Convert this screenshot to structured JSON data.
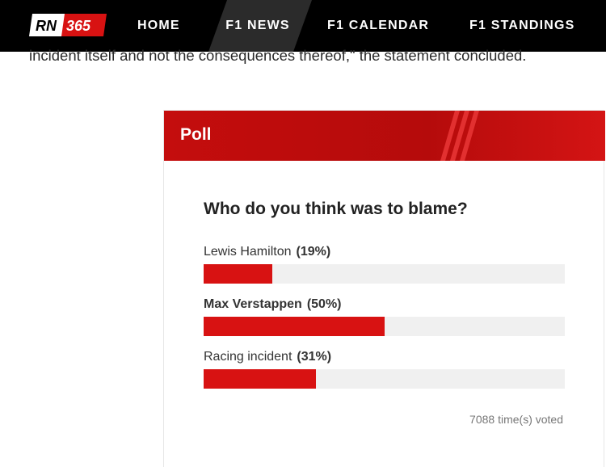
{
  "nav": {
    "logo_text": "RN 365",
    "items": [
      {
        "label": "HOME"
      },
      {
        "label": "F1 NEWS"
      },
      {
        "label": "F1 CALENDAR"
      },
      {
        "label": "F1 STANDINGS"
      }
    ],
    "active_index": 1
  },
  "article": {
    "visible_line": "incident itself and not the consequences thereof,\" the statement concluded."
  },
  "poll": {
    "header": "Poll",
    "question": "Who do you think was to blame?",
    "options": [
      {
        "name": "Lewis Hamilton",
        "percent_label": "(19%)",
        "percent": 19,
        "bold": false
      },
      {
        "name": "Max Verstappen",
        "percent_label": "(50%)",
        "percent": 50,
        "bold": true
      },
      {
        "name": "Racing incident",
        "percent_label": "(31%)",
        "percent": 31,
        "bold": false
      }
    ],
    "votes_text": "7088 time(s) voted"
  },
  "colors": {
    "nav_bg": "#000000",
    "brand_red": "#d81212",
    "bar_track": "#f0f0f0"
  }
}
